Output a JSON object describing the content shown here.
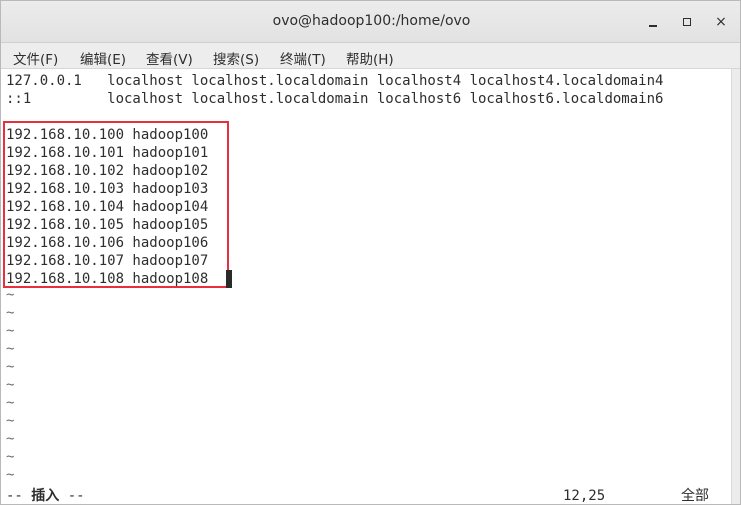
{
  "window": {
    "title": "ovo@hadoop100:/home/ovo",
    "controls": {
      "minimize": "minimize-icon",
      "maximize": "maximize-icon",
      "close": "×"
    }
  },
  "menubar": {
    "items": [
      {
        "label": "文件(F)"
      },
      {
        "label": "编辑(E)"
      },
      {
        "label": "查看(V)"
      },
      {
        "label": "搜索(S)"
      },
      {
        "label": "终端(T)"
      },
      {
        "label": "帮助(H)"
      }
    ]
  },
  "editor": {
    "lines": [
      "127.0.0.1   localhost localhost.localdomain localhost4 localhost4.localdomain4",
      "::1         localhost localhost.localdomain localhost6 localhost6.localdomain6",
      "",
      "192.168.10.100 hadoop100",
      "192.168.10.101 hadoop101",
      "192.168.10.102 hadoop102",
      "192.168.10.103 hadoop103",
      "192.168.10.104 hadoop104",
      "192.168.10.105 hadoop105",
      "192.168.10.106 hadoop106",
      "192.168.10.107 hadoop107",
      "192.168.10.108 hadoop108"
    ],
    "empty_line_marker": "~",
    "status": {
      "mode_prefix": "-- ",
      "mode": "插入",
      "mode_suffix": " --",
      "position": "12,25",
      "scroll": "全部"
    }
  },
  "colors": {
    "highlight_border": "#e5313d",
    "text": "#2e2e2e",
    "background": "#ffffff"
  }
}
